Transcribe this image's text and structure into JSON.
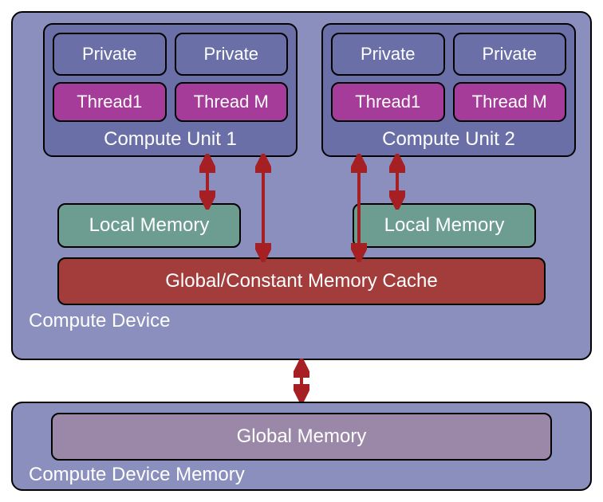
{
  "device": {
    "label": "Compute Device",
    "units": [
      {
        "label": "Compute Unit 1",
        "private": [
          "Private",
          "Private"
        ],
        "threads": [
          "Thread1",
          "Thread M"
        ]
      },
      {
        "label": "Compute Unit 2",
        "private": [
          "Private",
          "Private"
        ],
        "threads": [
          "Thread1",
          "Thread M"
        ]
      }
    ],
    "local_memory": [
      "Local Memory",
      "Local Memory"
    ],
    "cache": "Global/Constant Memory Cache"
  },
  "device_memory": {
    "label": "Compute Device Memory",
    "global": "Global Memory"
  },
  "colors": {
    "device_bg": "#8a8fbd",
    "unit_bg": "#6b6fa8",
    "thread_bg": "#a63c9a",
    "local_bg": "#6d9d90",
    "cache_bg": "#a23d3c",
    "global_bg": "#9b88a8",
    "arrow": "#a61f22"
  }
}
